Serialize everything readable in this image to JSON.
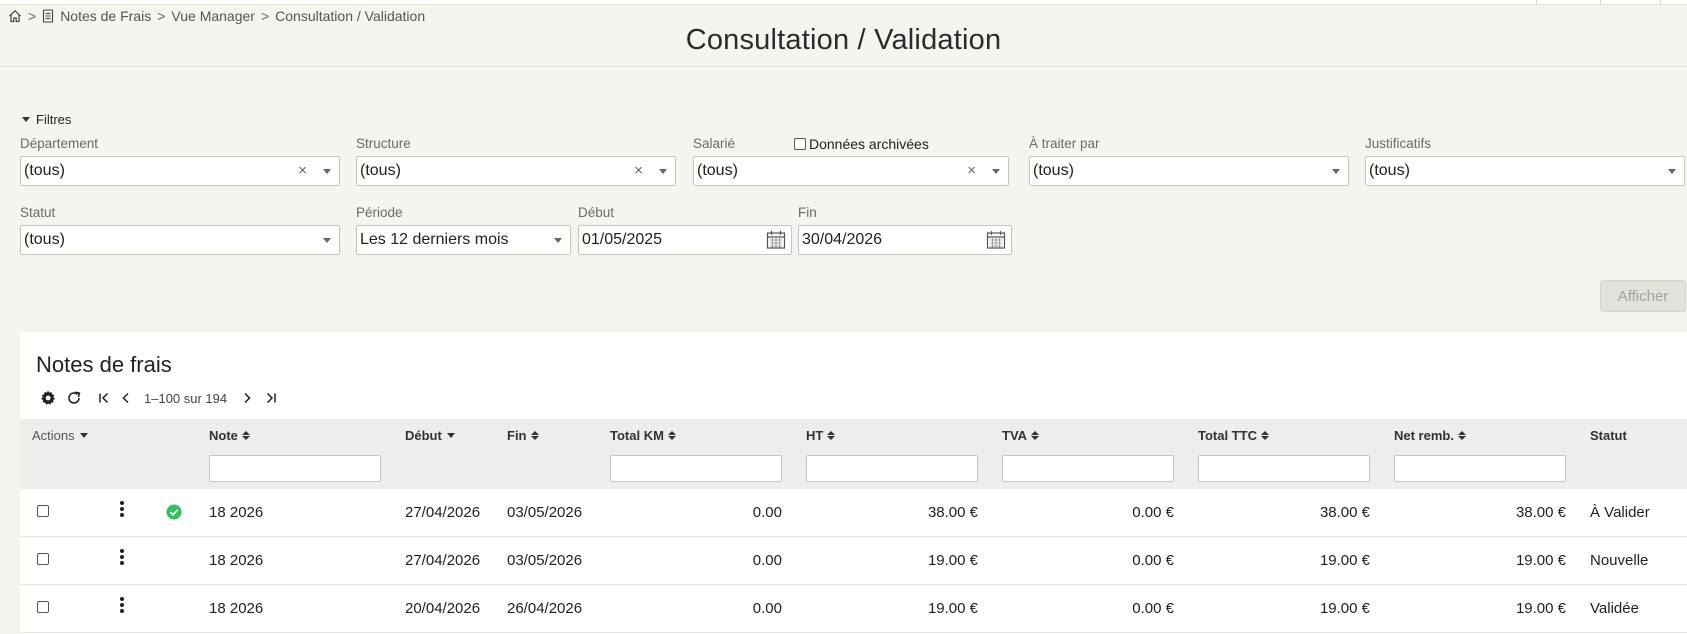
{
  "breadcrumb": {
    "items": [
      "Notes de Frais",
      "Vue Manager",
      "Consultation / Validation"
    ],
    "separator": ">"
  },
  "page_title": "Consultation / Validation",
  "filters": {
    "toggle_label": "Filtres",
    "departement": {
      "label": "Département",
      "value": "(tous)"
    },
    "structure": {
      "label": "Structure",
      "value": "(tous)"
    },
    "salarie": {
      "label": "Salarié",
      "value": "(tous)"
    },
    "archive_label": "Données archivées",
    "a_traiter_par": {
      "label": "À traiter par",
      "value": "(tous)"
    },
    "justificatifs": {
      "label": "Justificatifs",
      "value": "(tous)"
    },
    "statut": {
      "label": "Statut",
      "value": "(tous)"
    },
    "periode": {
      "label": "Période",
      "value": "Les 12 derniers mois"
    },
    "debut": {
      "label": "Début",
      "value": "01/05/2025"
    },
    "fin": {
      "label": "Fin",
      "value": "30/04/2026"
    },
    "submit_label": "Afficher"
  },
  "grid": {
    "title": "Notes de frais",
    "pager_text": "1–100 sur 194",
    "columns": {
      "actions": "Actions",
      "note": "Note",
      "debut": "Début",
      "fin": "Fin",
      "total_km": "Total KM",
      "ht": "HT",
      "tva": "TVA",
      "total_ttc": "Total TTC",
      "net_remb": "Net remb.",
      "statut": "Statut"
    },
    "rows": [
      {
        "note": "18 2026",
        "debut": "27/04/2026",
        "fin": "03/05/2026",
        "total_km": "0.00",
        "ht": "38.00 €",
        "tva": "0.00 €",
        "total_ttc": "38.00 €",
        "net_remb": "38.00 €",
        "statut": "À Valider",
        "validated_icon": true
      },
      {
        "note": "18 2026",
        "debut": "27/04/2026",
        "fin": "03/05/2026",
        "total_km": "0.00",
        "ht": "19.00 €",
        "tva": "0.00 €",
        "total_ttc": "19.00 €",
        "net_remb": "19.00 €",
        "statut": "Nouvelle",
        "validated_icon": false
      },
      {
        "note": "18 2026",
        "debut": "20/04/2026",
        "fin": "26/04/2026",
        "total_km": "0.00",
        "ht": "19.00 €",
        "tva": "0.00 €",
        "total_ttc": "19.00 €",
        "net_remb": "19.00 €",
        "statut": "Validée",
        "validated_icon": false
      }
    ]
  },
  "colors": {
    "background": "#f6f4ef",
    "success_icon": "#2ec15a"
  },
  "icons": [
    "home-icon",
    "document-icon",
    "settings-icon",
    "refresh-icon",
    "first-page-icon",
    "prev-page-icon",
    "next-page-icon",
    "last-page-icon",
    "calendar-icon",
    "kebab-menu-icon",
    "check-circle-icon"
  ]
}
